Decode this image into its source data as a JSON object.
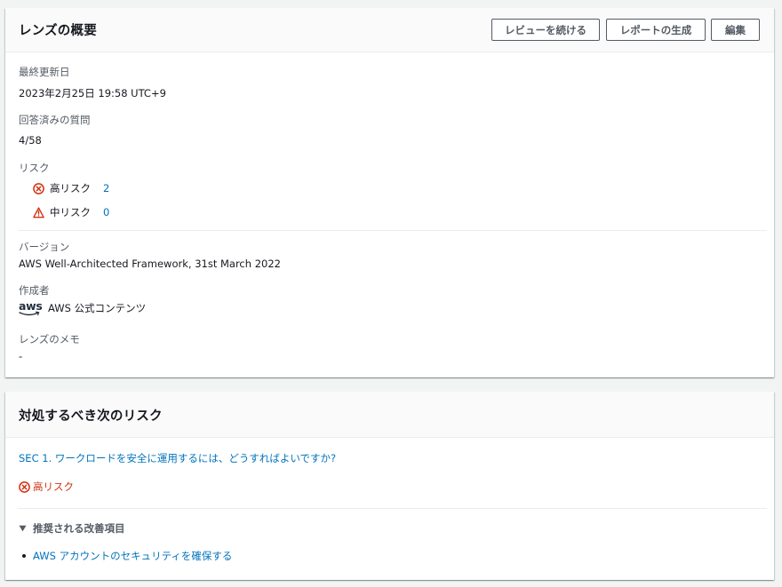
{
  "overview": {
    "title": "レンズの概要",
    "buttons": {
      "continue_review": "レビューを続ける",
      "generate_report": "レポートの生成",
      "edit": "編集"
    },
    "last_updated_label": "最終更新日",
    "last_updated_value": "2023年2月25日 19:58 UTC+9",
    "answered_label": "回答済みの質問",
    "answered_value": "4/58",
    "risk_label": "リスク",
    "high_risk_label": "高リスク",
    "high_risk_count": "2",
    "medium_risk_label": "中リスク",
    "medium_risk_count": "0",
    "version_label": "バージョン",
    "version_value": "AWS Well-Architected Framework, 31st March 2022",
    "author_label": "作成者",
    "author_logo_text": "aws",
    "author_value": "AWS 公式コンテンツ",
    "notes_label": "レンズのメモ",
    "notes_value": "-"
  },
  "next_risks": {
    "title": "対処するべき次のリスク",
    "question_link": "SEC 1. ワークロードを安全に運用するには、どうすればよいですか?",
    "risk_badge": "高リスク",
    "improvements_label": "推奨される改善項目",
    "improvements": [
      "AWS アカウントのセキュリティを確保する"
    ]
  },
  "colors": {
    "link": "#0073bb",
    "high_risk": "#d13212",
    "text": "#16191f",
    "secondary": "#545b64"
  }
}
